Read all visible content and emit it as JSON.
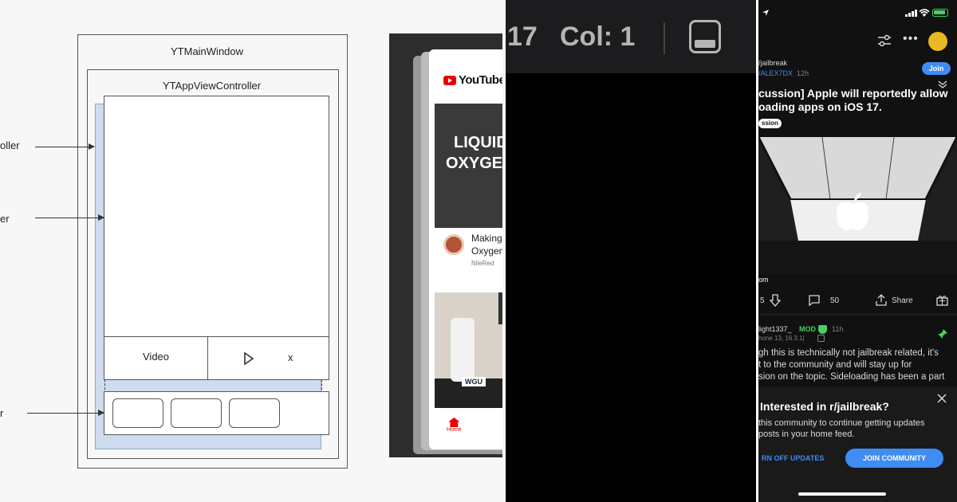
{
  "diagram": {
    "main_window": "YTMainWindow",
    "app_view_controller": "YTAppViewController",
    "left_labels": [
      "oller",
      "er",
      "r"
    ],
    "video_label": "Video",
    "close_label": "x"
  },
  "youtube_preview": {
    "logo_text": "YouTube",
    "thumb_title_line1": "LIQUID",
    "thumb_title_line2": "OXYGEN",
    "video_title_line1": "Making",
    "video_title_line2": "Oxygen",
    "channel": "NileRed",
    "jug_label": "WGU",
    "home_label": "Home"
  },
  "editor": {
    "line_fragment": "17",
    "col_text": "Col: 1"
  },
  "reddit": {
    "community": "/jailbreak",
    "author": "/ALEX7DX",
    "time": "12h",
    "join_label": "Join",
    "post_title_line1": "cussion] Apple will reportedly allow",
    "post_title_line2": "oading apps on iOS 17.",
    "flair": "ssion",
    "image_caption": "om",
    "vote_count": "5",
    "comments_count": "50",
    "share_label": "Share",
    "commenter": "light1337_",
    "mod_badge": "MOD",
    "comment_time": "11h",
    "device": "hone 13, 16.3.1|",
    "comment_line1": "gh this is technically not jailbreak related, it's",
    "comment_line2": "t to the community and will stay up for",
    "comment_line3": "sion on the topic. Sideloading has been a part",
    "prompt_title": "Interested in r/jailbreak?",
    "prompt_line1": "this community to continue getting updates",
    "prompt_line2": "posts in your home feed.",
    "turn_off_label": "RN OFF UPDATES",
    "join_community_label": "JOIN COMMUNITY",
    "accent": "#3f8cf2",
    "mod_color": "#46d160"
  }
}
